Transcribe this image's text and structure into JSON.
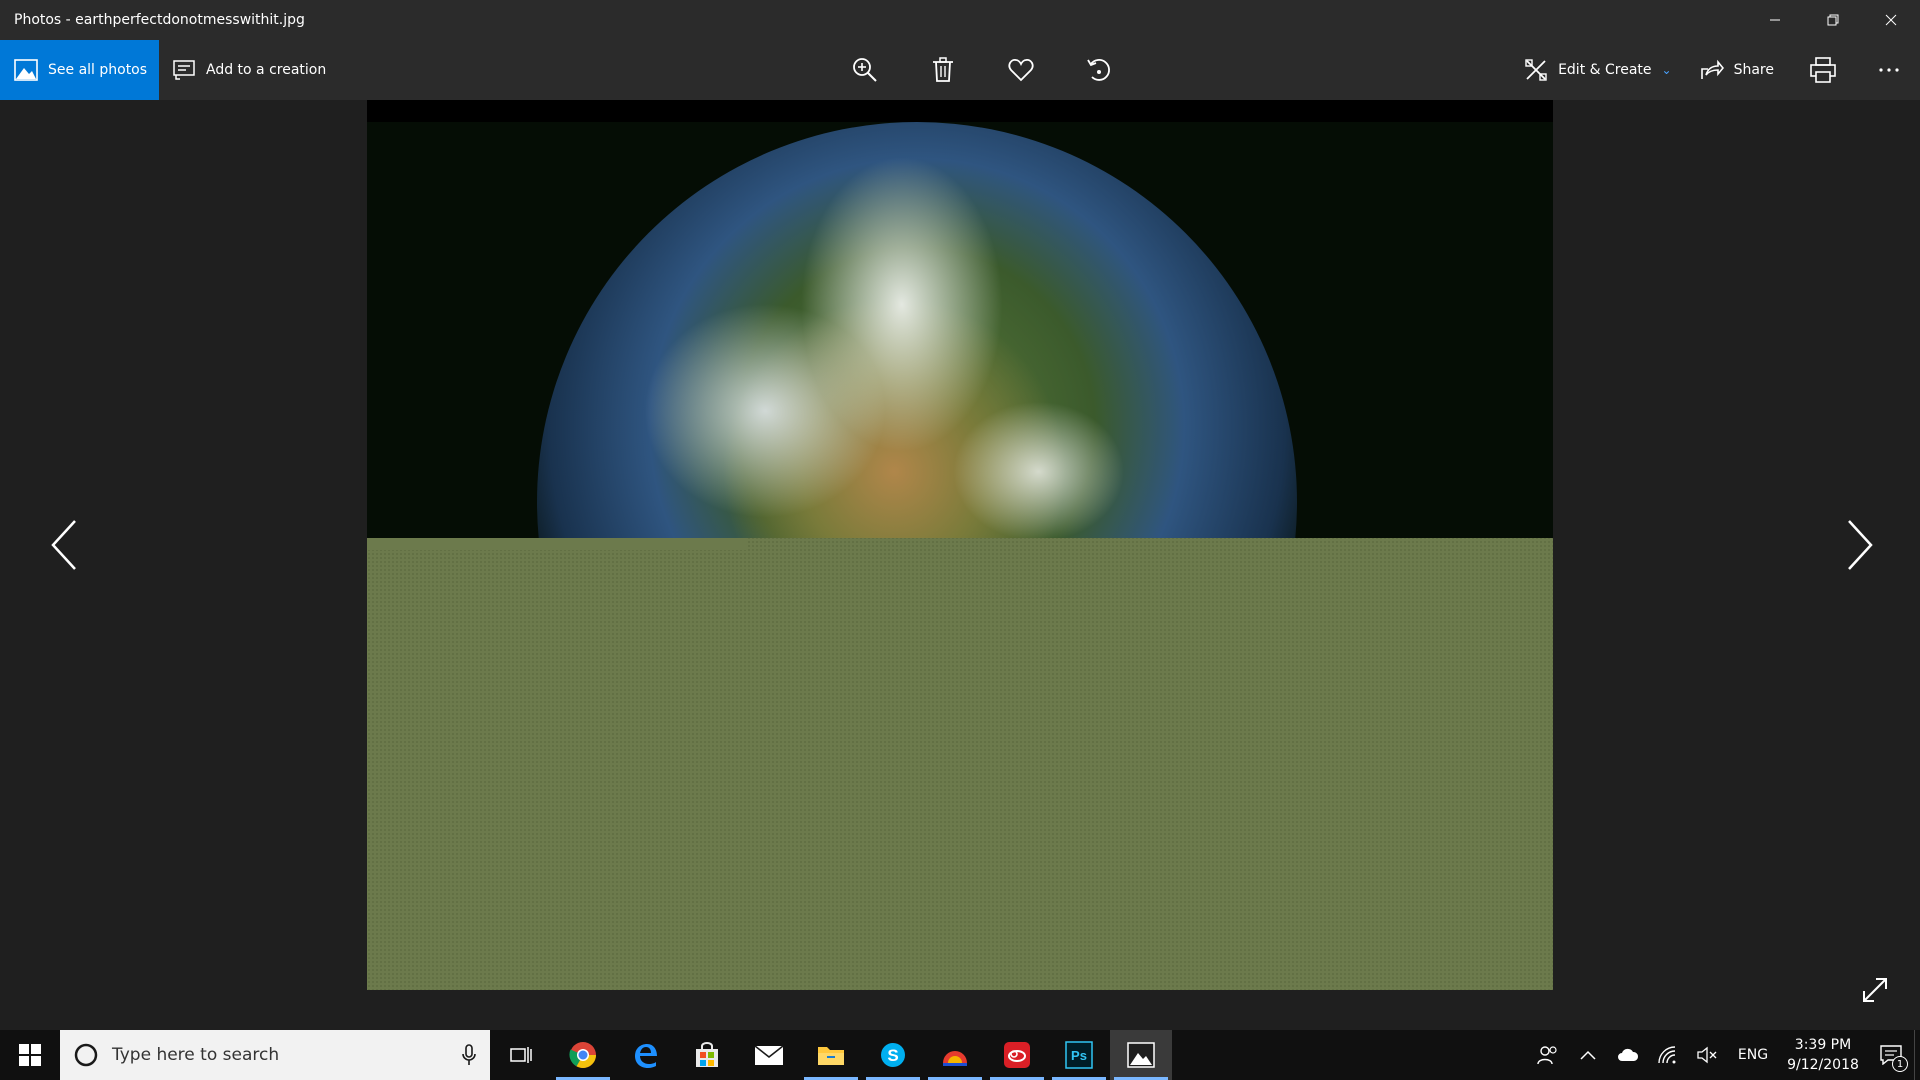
{
  "window": {
    "title": "Photos - earthperfectdonotmesswithit.jpg"
  },
  "toolbar": {
    "see_all_label": "See all photos",
    "add_creation_label": "Add to a creation",
    "edit_create_label": "Edit & Create",
    "share_label": "Share"
  },
  "image": {
    "filename": "earthperfectdonotmesswithit.jpg",
    "visible_fraction_decoded": 0.49
  },
  "taskbar": {
    "search_placeholder": "Type here to search",
    "apps": [
      "chrome",
      "edge",
      "store",
      "mail",
      "file-explorer",
      "skype",
      "app-red-orange",
      "creative-cloud",
      "photoshop",
      "photos"
    ],
    "tray": {
      "language": "ENG",
      "time": "3:39 PM",
      "date": "9/12/2018",
      "notification_count": "1"
    }
  },
  "colors": {
    "accent": "#0078d7",
    "titlebar": "#2b2b2b",
    "background": "#1f1f1f",
    "image_fill": "#6c7a4c",
    "taskbar": "#101010"
  }
}
